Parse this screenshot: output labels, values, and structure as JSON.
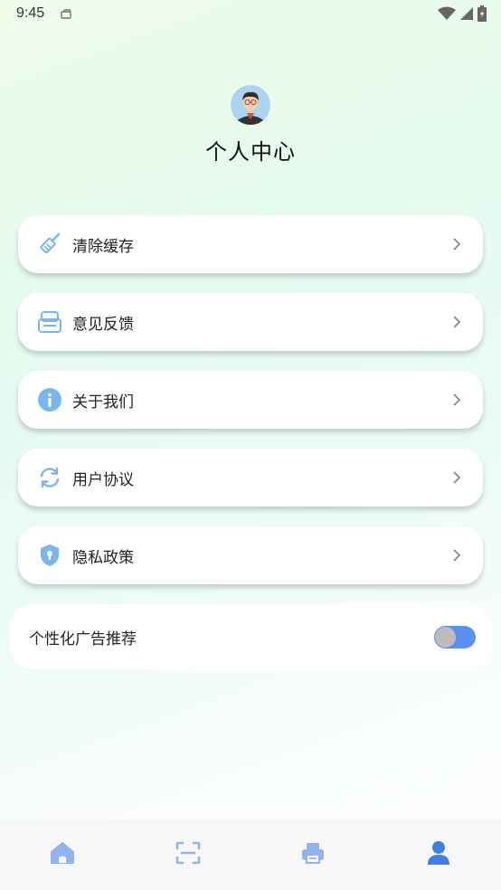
{
  "status_bar": {
    "time": "9:45"
  },
  "profile": {
    "title": "个人中心"
  },
  "menu": {
    "items": [
      {
        "label": "清除缓存",
        "icon": "broom-icon"
      },
      {
        "label": "意见反馈",
        "icon": "feedback-icon"
      },
      {
        "label": "关于我们",
        "icon": "info-icon"
      },
      {
        "label": "用户协议",
        "icon": "refresh-icon"
      },
      {
        "label": "隐私政策",
        "icon": "shield-icon"
      }
    ]
  },
  "ad_recommend": {
    "label": "个性化广告推荐",
    "enabled": true
  },
  "bottom_nav": {
    "items": [
      {
        "icon": "home-icon"
      },
      {
        "icon": "scan-icon"
      },
      {
        "icon": "printer-icon"
      },
      {
        "icon": "user-icon",
        "active": true
      }
    ]
  },
  "colors": {
    "accent": "#5b8ff0",
    "icon_blue": "#79b6ee",
    "nav_inactive": "#8fb3f3"
  }
}
